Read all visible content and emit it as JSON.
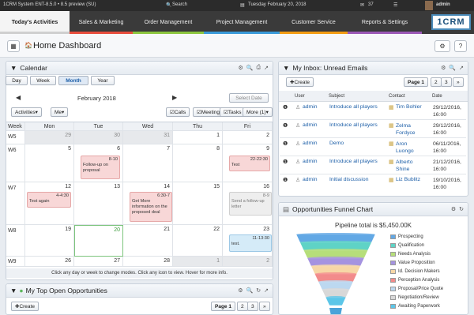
{
  "topbar": {
    "system": "1CRM System ENT-8.5.0 • 8.5 preview (SU)",
    "search": "Search",
    "date": "Tuesday February 20, 2018",
    "mail_count": "37",
    "user": "admin"
  },
  "nav": {
    "tabs": [
      {
        "label": "Today's Activities",
        "color": "#e5e5e5"
      },
      {
        "label": "Sales & Marketing",
        "color": "#e84d3d"
      },
      {
        "label": "Order Management",
        "color": "#8cc63f"
      },
      {
        "label": "Project Management",
        "color": "#3a9ad9"
      },
      {
        "label": "Customer Service",
        "color": "#f39c12"
      },
      {
        "label": "Reports & Settings",
        "color": "#9b59b6"
      }
    ],
    "logo": "1CRM"
  },
  "page": {
    "title": "Home Dashboard"
  },
  "calendar": {
    "title": "Calendar",
    "tabs": [
      "Day",
      "Week",
      "Month",
      "Year"
    ],
    "active_tab": "Month",
    "select_date": "Select Date",
    "month": "February 2018",
    "activities_label": "Activities",
    "me_label": "Me",
    "filters": [
      "Calls",
      "Meetings",
      "Tasks",
      "More (1)"
    ],
    "headers": [
      "Week",
      "Mon",
      "Tue",
      "Wed",
      "Thu",
      "Fri"
    ],
    "weeks": [
      "W5",
      "W6",
      "W7",
      "W8",
      "W9"
    ],
    "days": [
      [
        "29",
        "30",
        "31",
        "1",
        "2"
      ],
      [
        "5",
        "6",
        "7",
        "8",
        "9"
      ],
      [
        "12",
        "13",
        "14",
        "15",
        "16"
      ],
      [
        "19",
        "20",
        "21",
        "22",
        "23"
      ],
      [
        "26",
        "27",
        "28",
        "1",
        "2"
      ]
    ],
    "events": {
      "tue_w6": {
        "time": "8-10",
        "text": "Follow-up on proposal"
      },
      "fri_w6": {
        "time": "22-22:30",
        "text": "Test"
      },
      "mon_w7": {
        "time": "4-4:30",
        "text": "Test again"
      },
      "wed_w7": {
        "time": "6:30-7",
        "text": "Get More information on the proposed deal"
      },
      "fri_w7": {
        "time": "8-9",
        "text": "Send a follow-up letter"
      },
      "fri_w8": {
        "time": "11-13:30",
        "text": "test."
      }
    },
    "footer": "Click any day or week to change modes. Click any icon to view. Hover for more info."
  },
  "opportunities": {
    "title": "My Top Open Opportunities",
    "create": "Create",
    "page": "Page 1",
    "pages": [
      "2",
      "3"
    ]
  },
  "inbox": {
    "title": "My Inbox: Unread Emails",
    "create": "Create",
    "page": "Page 1",
    "pages": [
      "2",
      "3"
    ],
    "columns": [
      "User",
      "Subject",
      "Contact",
      "Date"
    ],
    "rows": [
      {
        "user": "admin",
        "subject": "Introduce all players",
        "contact": "Tim Bohler",
        "date": "29/12/2016, 16:00"
      },
      {
        "user": "admin",
        "subject": "Introduce all players",
        "contact": "Zelma Fordyce",
        "date": "29/12/2016, 16:00"
      },
      {
        "user": "admin",
        "subject": "Demo",
        "contact": "Aron Luongo",
        "date": "06/11/2016, 16:00"
      },
      {
        "user": "admin",
        "subject": "Introduce all players",
        "contact": "Alberto Shine",
        "date": "21/12/2016, 16:00"
      },
      {
        "user": "admin",
        "subject": "Initial discussion",
        "contact": "Liz Bublitz",
        "date": "19/10/2016, 16:00"
      }
    ]
  },
  "funnel": {
    "title": "Opportunities Funnel Chart",
    "pipeline": "Pipeline total is $5,450.00K",
    "stages": [
      {
        "label": "Prospecting",
        "color": "#62a8e5"
      },
      {
        "label": "Qualification",
        "color": "#5fd3c6"
      },
      {
        "label": "Needs Analysis",
        "color": "#b6de7a"
      },
      {
        "label": "Value Proposition",
        "color": "#a593e0"
      },
      {
        "label": "Id. Decision Makers",
        "color": "#f7d7a6"
      },
      {
        "label": "Perception Analysis",
        "color": "#f28b8b"
      },
      {
        "label": "Proposal/Price Quote",
        "color": "#bcd8f0"
      },
      {
        "label": "Negotiation/Review",
        "color": "#d8d8d8"
      },
      {
        "label": "Awaiting Paperwork",
        "color": "#5cc6e8"
      }
    ]
  }
}
